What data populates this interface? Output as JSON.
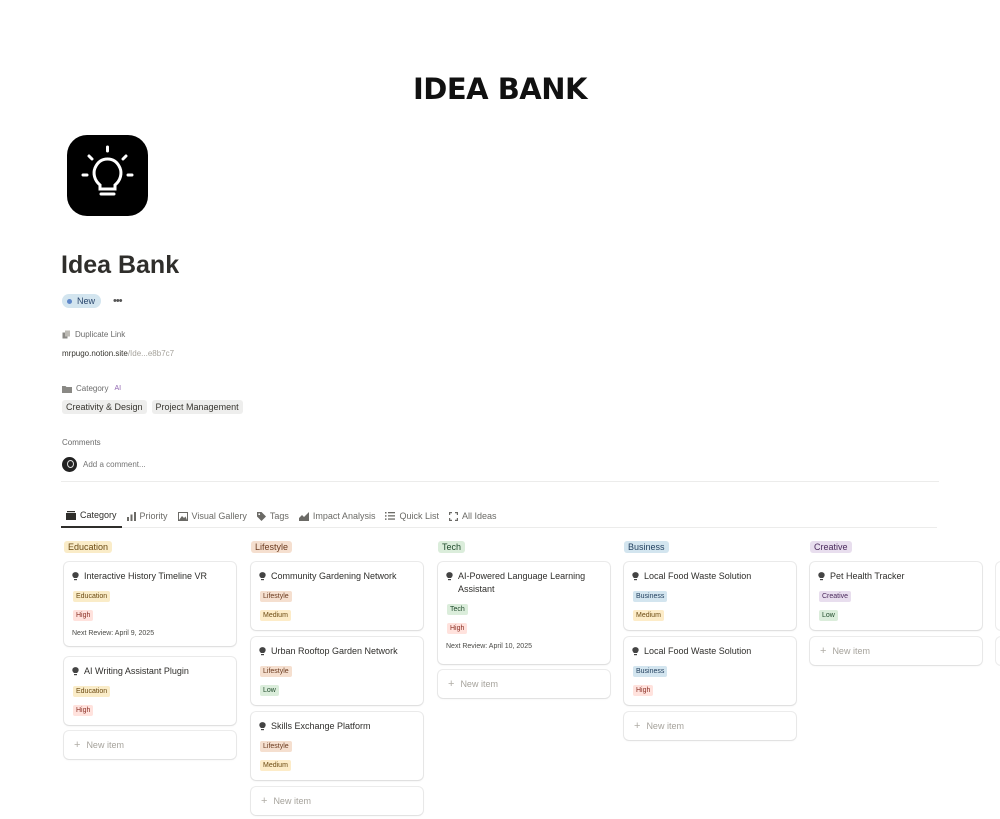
{
  "banner": {
    "title": "IDEA BANK"
  },
  "page": {
    "title": "Idea Bank",
    "icon": "lightbulb-icon"
  },
  "status": {
    "label": "New",
    "color": "#d3e5ef"
  },
  "properties": {
    "link": {
      "label": "Duplicate Link",
      "value_main": "mrpugo.notion.site",
      "value_muted": "/Ide...e8b7c7"
    },
    "category": {
      "label": "Category",
      "ai_label": "AI",
      "tags": [
        "Creativity & Design",
        "Project Management"
      ]
    },
    "comments": {
      "label": "Comments",
      "placeholder": "Add a comment..."
    }
  },
  "tabs": [
    {
      "label": "Category",
      "icon": "board-icon",
      "active": true
    },
    {
      "label": "Priority",
      "icon": "bar-chart-icon",
      "active": false
    },
    {
      "label": "Visual Gallery",
      "icon": "image-icon",
      "active": false
    },
    {
      "label": "Tags",
      "icon": "tag-icon",
      "active": false
    },
    {
      "label": "Impact Analysis",
      "icon": "chart-icon",
      "active": false
    },
    {
      "label": "Quick List",
      "icon": "list-icon",
      "active": false
    },
    {
      "label": "All Ideas",
      "icon": "expand-icon",
      "active": false
    }
  ],
  "board": {
    "new_item_label": "New item",
    "columns": [
      {
        "title": "Education",
        "bg": "#faecc8",
        "fg": "#6b4a12",
        "cards": [
          {
            "title": "Interactive History Timeline VR",
            "category": "Education",
            "priority": "High",
            "review": "Next Review: April 9, 2025"
          },
          {
            "title": "AI Writing Assistant Plugin",
            "category": "Education",
            "priority": "High",
            "review": ""
          }
        ]
      },
      {
        "title": "Lifestyle",
        "bg": "#f5dfcf",
        "fg": "#6b3a1e",
        "cards": [
          {
            "title": "Community Gardening Network",
            "category": "Lifestyle",
            "priority": "Medium",
            "review": ""
          },
          {
            "title": "Urban Rooftop Garden Network",
            "category": "Lifestyle",
            "priority": "Low",
            "review": ""
          },
          {
            "title": "Skills Exchange Platform",
            "category": "Lifestyle",
            "priority": "Medium",
            "review": ""
          }
        ]
      },
      {
        "title": "Tech",
        "bg": "#dbeddb",
        "fg": "#1f4a2b",
        "cards": [
          {
            "title": "AI-Powered Language Learning Assistant",
            "category": "Tech",
            "priority": "High",
            "review": "Next Review: April 10, 2025"
          }
        ]
      },
      {
        "title": "Business",
        "bg": "#d3e5ef",
        "fg": "#1f3d5c",
        "cards": [
          {
            "title": "Local Food Waste Solution",
            "category": "Business",
            "priority": "Medium",
            "review": ""
          },
          {
            "title": "Local Food Waste Solution",
            "category": "Business",
            "priority": "High",
            "review": ""
          }
        ]
      },
      {
        "title": "Creative",
        "bg": "#e8deee",
        "fg": "#4a2a5c",
        "cards": [
          {
            "title": "Pet Health Tracker",
            "category": "Creative",
            "priority": "Low",
            "review": ""
          }
        ]
      }
    ]
  },
  "priority_colors": {
    "High": {
      "bg": "#ffe2dd",
      "fg": "#8a2f24"
    },
    "Medium": {
      "bg": "#fdecc8",
      "fg": "#6b4a12"
    },
    "Low": {
      "bg": "#dbeddb",
      "fg": "#1f4a2b"
    }
  }
}
